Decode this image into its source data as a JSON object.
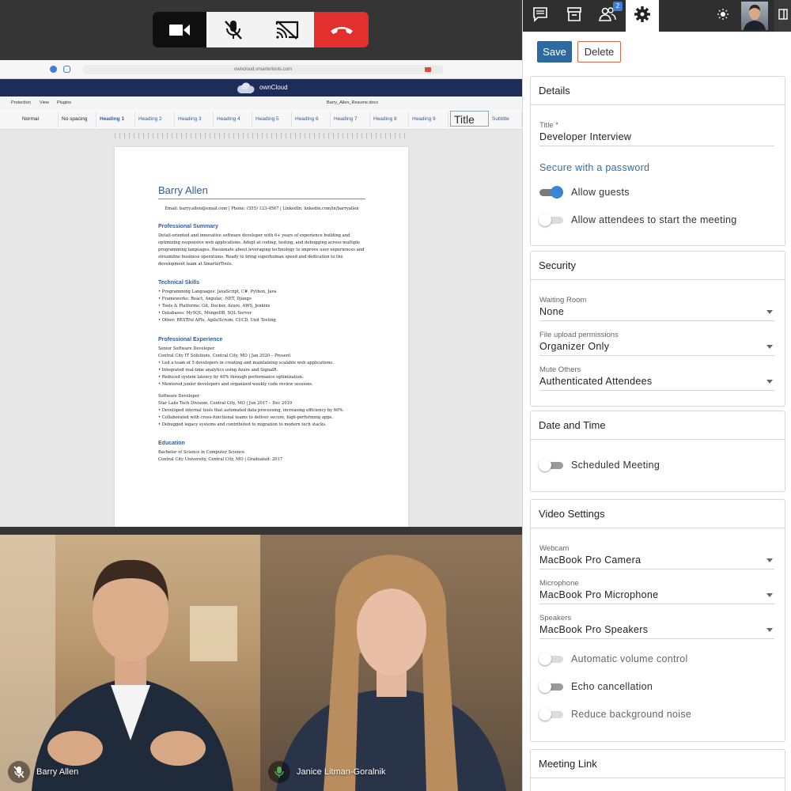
{
  "call_controls": {
    "video": "video-camera-icon",
    "mic": "microphone-muted-icon",
    "share": "screen-share-off-icon",
    "end": "hang-up-icon",
    "end_color": "#e3302f"
  },
  "shared_screen": {
    "url": "owncloud.smartertools.com",
    "app_name": "ownCloud",
    "menu": [
      "Protection",
      "View",
      "Plugins"
    ],
    "doc_title": "Barry_Allen_Resume.docx",
    "styles": [
      "Normal",
      "No spacing",
      "Heading 1",
      "Heading 2",
      "Heading 3",
      "Heading 4",
      "Heading 5",
      "Heading 6",
      "Heading 7",
      "Heading 8",
      "Heading 9",
      "Title",
      "Subtitle"
    ],
    "resume": {
      "name": "Barry Allen",
      "contact": "Email: barry.allen@email.com | Phone: (555) 123-4567 | LinkedIn: linkedin.com/in/barryallen",
      "summary_title": "Professional Summary",
      "summary": "Detail-oriented and innovative software developer with 6+ years of experience building and optimizing responsive web applications. Adept at coding, testing, and debugging across multiple programming languages. Passionate about leveraging technology to improve user experiences and streamline business operations. Ready to bring superhuman speed and dedication to the development team at SmarterTools.",
      "skills_title": "Technical Skills",
      "skills": "• Programming Languages: JavaScript, C#, Python, Java\n• Frameworks: React, Angular, .NET, Django\n• Tools & Platforms: Git, Docker, Azure, AWS, Jenkins\n• Databases: MySQL, MongoDB, SQL Server\n• Other: RESTful APIs, Agile/Scrum, CI/CD, Unit Testing",
      "experience_title": "Professional Experience",
      "job1": "Senior Software Developer\nCentral City IT Solutions, Central City, MO | Jan 2020 – Present\n• Led a team of 5 developers in creating and maintaining scalable web applications.\n• Integrated real-time analytics using Azure and SignalR.\n• Reduced system latency by 40% through performance optimization.\n• Mentored junior developers and organized weekly code review sessions.",
      "job2": "Software Developer\nStar Labs Tech Division, Central City, MO | Jun 2017 – Dec 2019\n• Developed internal tools that automated data processing, increasing efficiency by 60%.\n• Collaborated with cross-functional teams to deliver secure, high-performing apps.\n• Debugged legacy systems and contributed to migration to modern tech stacks.",
      "education_title": "Education",
      "education": "Bachelor of Science in Computer Science\nCentral City University, Central City, MO | Graduated: 2017"
    }
  },
  "participants": [
    {
      "name": "Barry Allen",
      "mic_icon": "microphone-muted-icon"
    },
    {
      "name": "Janice Litman-Goralnik",
      "mic_icon": "microphone-active-icon",
      "mic_color": "#4caf50"
    }
  ],
  "panel": {
    "tabs": [
      "chat-icon",
      "archive-icon",
      "people-icon",
      "settings-icon"
    ],
    "people_badge": "2",
    "theme_icon": "sun-icon",
    "save_label": "Save",
    "delete_label": "Delete",
    "details": {
      "header": "Details",
      "title_label": "Title *",
      "title_value": "Developer Interview",
      "password_link": "Secure with a password",
      "allow_guests": {
        "label": "Allow guests",
        "on": true
      },
      "allow_attendees": {
        "label": "Allow attendees to start the meeting",
        "on": false
      }
    },
    "security": {
      "header": "Security",
      "waiting_room_label": "Waiting Room",
      "waiting_room_value": "None",
      "upload_label": "File upload permissions",
      "upload_value": "Organizer Only",
      "mute_label": "Mute Others",
      "mute_value": "Authenticated Attendees"
    },
    "datetime": {
      "header": "Date and Time",
      "scheduled": {
        "label": "Scheduled Meeting",
        "on": false
      }
    },
    "video": {
      "header": "Video Settings",
      "webcam_label": "Webcam",
      "webcam_value": "MacBook Pro Camera",
      "mic_label": "Microphone",
      "mic_value": "MacBook Pro Microphone",
      "speakers_label": "Speakers",
      "speakers_value": "MacBook Pro Speakers",
      "auto_volume": {
        "label": "Automatic volume control",
        "on": false
      },
      "echo": {
        "label": "Echo cancellation",
        "on": false
      },
      "noise": {
        "label": "Reduce background noise",
        "on": false
      }
    },
    "meeting_link": {
      "header": "Meeting Link"
    },
    "accent_color": "#2e6aa1"
  }
}
